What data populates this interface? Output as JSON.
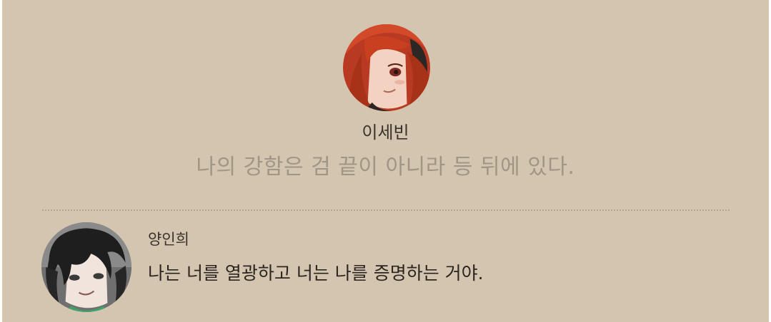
{
  "featured": {
    "name": "이세빈",
    "quote": "나의 강함은 검 끝이 아니라 등 뒤에 있다.",
    "avatar_icon": "red-haired-character-avatar"
  },
  "reply": {
    "name": "양인희",
    "text": "나는 너를 열광하고 너는 나를 증명하는 거야.",
    "avatar_icon": "dark-haired-character-avatar"
  },
  "colors": {
    "panel_background": "#d4c5b0",
    "quote_text": "#a19685",
    "divider": "#b3a792"
  }
}
